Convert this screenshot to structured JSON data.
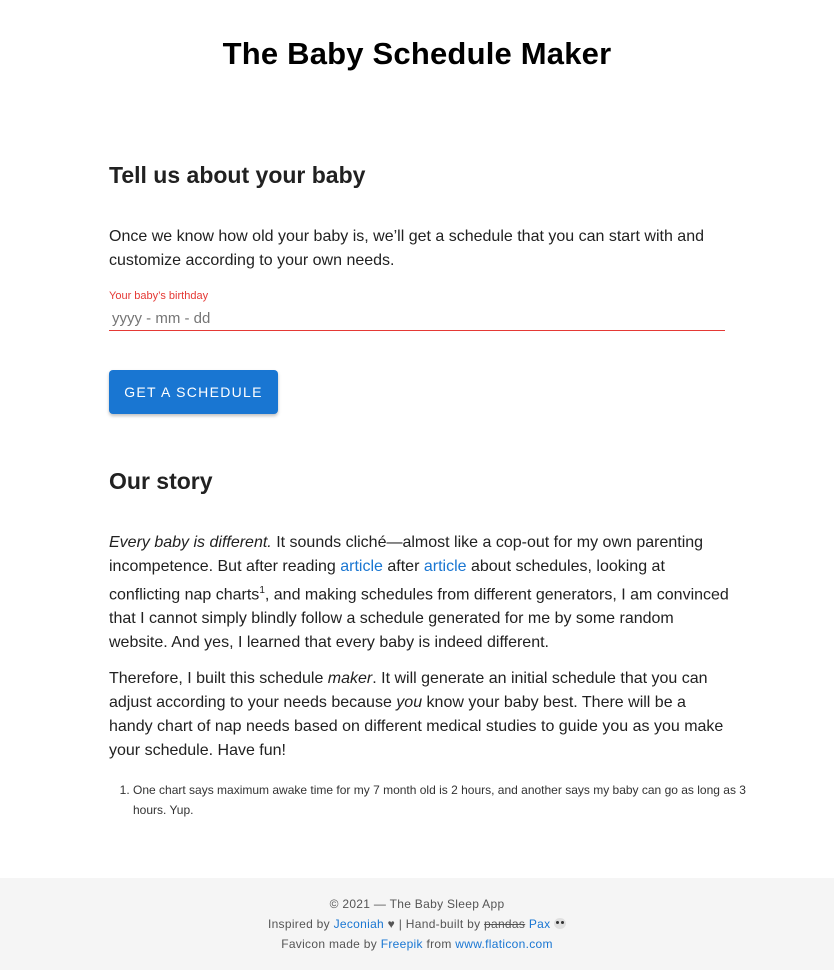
{
  "header": {
    "title": "The Baby Schedule Maker"
  },
  "intro": {
    "heading": "Tell us about your baby",
    "description": "Once we know how old your baby is, we’ll get a schedule that you can start with and customize according to your own needs.",
    "birthday_label": "Your baby’s birthday",
    "birthday_placeholder": "yyyy - mm - dd",
    "submit_label": "GET A SCHEDULE"
  },
  "story": {
    "heading": "Our story",
    "p1_em": "Every baby is different.",
    "p1_a": " It sounds cliché—almost like a cop-out for my own parenting incompetence. But after reading ",
    "p1_link1": "article",
    "p1_b": " after ",
    "p1_link2": "article",
    "p1_c": " about schedules, looking at conflicting nap charts",
    "p1_sup": "1",
    "p1_d": ", and making schedules from different generators, I am convinced that I cannot simply blindly follow a schedule generated for me by some random website. And yes, I learned that every baby is indeed different.",
    "p2_a": "Therefore, I built this schedule ",
    "p2_em1": "maker",
    "p2_b": ". It will generate an initial schedule that you can adjust according to your needs because ",
    "p2_em2": "you",
    "p2_c": " know your baby best. There will be a handy chart of nap needs based on different medical studies to guide you as you make your schedule. Have fun!",
    "footnote1": "One chart says maximum awake time for my 7 month old is 2 hours, and another says my baby can go as long as 3 hours. Yup."
  },
  "footer": {
    "copyright": "© 2021 — The Baby Sleep App",
    "inspired_prefix": "Inspired by ",
    "inspired_link": "Jeconiah",
    "inspired_heart": " ♥ | Hand-built by ",
    "strike": "pandas",
    "author_link": "Pax",
    "favicon_prefix": "Favicon made by ",
    "favicon_link": "Freepik",
    "favicon_mid": " from ",
    "favicon_site": "www.flaticon.com"
  },
  "colors": {
    "accent": "#1976d2",
    "error": "#e53935",
    "footer_bg": "#f5f5f5"
  }
}
